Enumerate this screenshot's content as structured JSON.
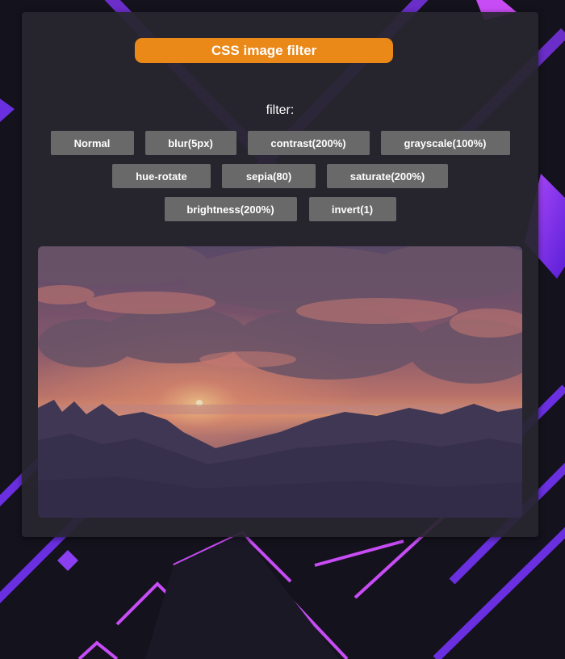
{
  "header": {
    "title": "CSS image filter"
  },
  "filter_label": "filter:",
  "buttons": {
    "normal": "Normal",
    "blur": "blur(5px)",
    "contrast": "contrast(200%)",
    "grayscale": "grayscale(100%)",
    "hue_rotate": "hue-rotate",
    "sepia": "sepia(80)",
    "saturate": "saturate(200%)",
    "brightness": "brightness(200%)",
    "invert": "invert(1)"
  },
  "colors": {
    "accent": "#ea8818",
    "button_bg": "#686968",
    "panel_bg": "#28262e",
    "background": "#14121c",
    "background_accent": "#8a3cf0"
  },
  "image": {
    "subject": "sunset over forest with clouds"
  }
}
